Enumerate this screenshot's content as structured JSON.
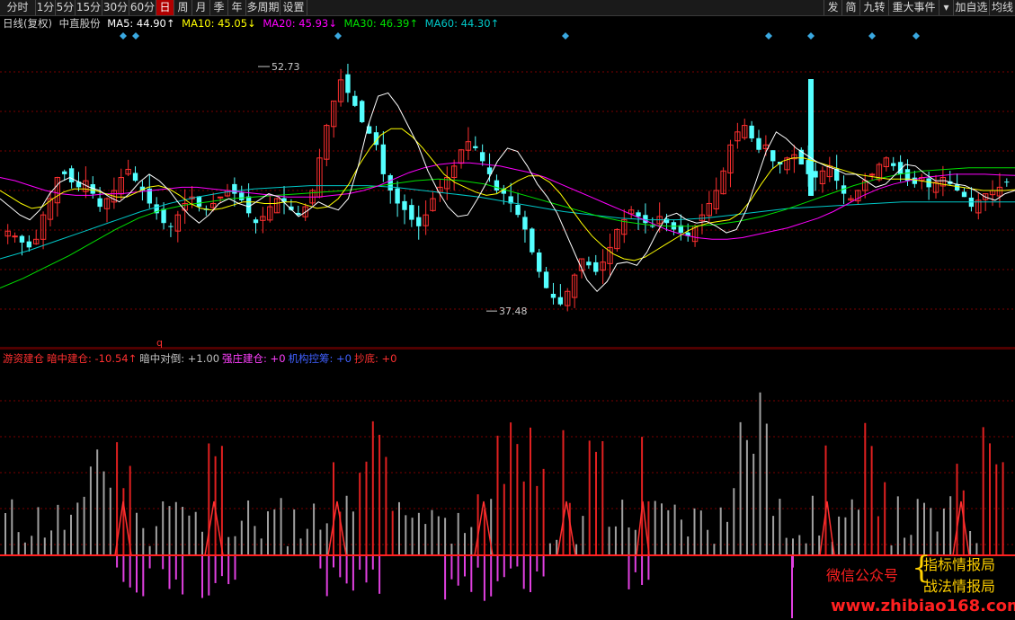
{
  "toolbar": {
    "left": [
      {
        "label": "分时",
        "icon": "candlestick-icon"
      },
      {
        "label": "1分"
      },
      {
        "label": "5分"
      },
      {
        "label": "15分"
      },
      {
        "label": "30分"
      },
      {
        "label": "60分"
      },
      {
        "label": "日",
        "active": true
      },
      {
        "label": "周"
      },
      {
        "label": "月"
      },
      {
        "label": "季"
      },
      {
        "label": "年"
      },
      {
        "label": "多周期"
      },
      {
        "label": "设置"
      }
    ],
    "right": [
      {
        "label": "发"
      },
      {
        "label": "简"
      },
      {
        "label": "九转"
      },
      {
        "label": "重大事件"
      },
      {
        "label": "▾",
        "icon": "dropdown-arrow-icon"
      },
      {
        "label": "加自选"
      },
      {
        "label": "均线"
      }
    ]
  },
  "legend": {
    "period": "日线(复权)",
    "stock": "中直股份",
    "ma5": {
      "label": "MA5: 44.90↑",
      "color": "#ffffff"
    },
    "ma10": {
      "label": "MA10: 45.05↓",
      "color": "#ffff00"
    },
    "ma20": {
      "label": "MA20: 45.93↓",
      "color": "#ff00ff"
    },
    "ma30": {
      "label": "MA30: 46.39↑",
      "color": "#00e000"
    },
    "ma60": {
      "label": "MA60: 44.30↑",
      "color": "#00c8c8"
    }
  },
  "annotations": {
    "high_label": "52.73",
    "low_label": "37.48",
    "q_marker": "q"
  },
  "indicator_legend": {
    "items": [
      {
        "label": "游资建仓",
        "color": "#ff3030"
      },
      {
        "label": "暗中建仓: -10.54↑",
        "color": "#ff3030"
      },
      {
        "label": "暗中对倒: +1.00",
        "color": "#c0c0c0"
      },
      {
        "label": "强庄建仓: +0",
        "color": "#ff40ff"
      },
      {
        "label": "机构控筹: +0",
        "color": "#4060ff"
      },
      {
        "label": "抄底: +0",
        "color": "#ff3030"
      }
    ]
  },
  "watermark": {
    "wechat": "微信公众号",
    "brace": "{",
    "line1": "指标情报局",
    "line2": "战法情报局",
    "url": "www.zhibiao168.com"
  },
  "colors": {
    "up": "#ff3030",
    "down": "#54ffff",
    "grid": "#7a0000",
    "ma5": "#ffffff",
    "ma10": "#ffff00",
    "ma20": "#ff00ff",
    "ma30": "#00e000",
    "ma60": "#00c8c8"
  },
  "chart_data": {
    "type": "candlestick",
    "price_range": [
      35.5,
      54.5
    ],
    "high": 52.73,
    "low": 37.48,
    "close_trace": [
      42.5,
      42.2,
      41.8,
      41.5,
      42.0,
      43.5,
      44.5,
      45.8,
      46.0,
      45.5,
      45.2,
      45.6,
      44.8,
      44.0,
      44.5,
      45.0,
      45.8,
      46.3,
      45.6,
      45.0,
      44.2,
      43.6,
      43.0,
      42.8,
      43.5,
      44.2,
      44.6,
      44.0,
      43.8,
      44.2,
      44.6,
      45.0,
      44.8,
      44.4,
      43.6,
      43.0,
      43.4,
      44.0,
      44.5,
      44.3,
      43.8,
      43.5,
      44.0,
      45.0,
      47.0,
      49.0,
      50.5,
      51.8,
      51.0,
      50.2,
      49.2,
      48.5,
      47.8,
      46.0,
      45.0,
      44.2,
      43.8,
      43.2,
      42.8,
      43.5,
      44.5,
      45.2,
      45.8,
      46.5,
      47.5,
      48.0,
      47.6,
      46.8,
      46.0,
      45.0,
      44.8,
      44.2,
      43.5,
      42.6,
      41.2,
      40.0,
      39.0,
      38.4,
      38.0,
      38.8,
      39.8,
      40.8,
      40.4,
      40.0,
      40.6,
      41.5,
      42.6,
      43.2,
      43.8,
      43.4,
      43.0,
      42.8,
      43.4,
      43.0,
      42.6,
      42.4,
      42.2,
      42.8,
      43.5,
      44.2,
      45.0,
      46.2,
      47.8,
      48.6,
      49.0,
      48.2,
      47.5,
      47.8,
      46.8,
      46.6,
      47.0,
      47.2,
      46.6,
      46.0,
      45.8,
      46.2,
      46.5,
      45.6,
      44.8,
      44.5,
      45.0,
      45.6,
      46.0,
      46.6,
      47.0,
      46.5,
      46.0,
      45.6,
      45.4,
      45.8,
      45.2,
      45.5,
      45.8,
      45.4,
      45.0,
      44.6,
      44.0,
      44.4,
      44.8,
      45.0,
      45.2,
      45.5
    ],
    "ma_curves": {
      "ma5": [
        44.5,
        44.0,
        43.5,
        43.2,
        43.8,
        44.8,
        45.5,
        45.8,
        45.5,
        45.2,
        45.0,
        44.6,
        44.3,
        44.8,
        45.5,
        46.0,
        45.6,
        45.0,
        44.2,
        43.5,
        43.0,
        43.5,
        44.2,
        44.5,
        44.2,
        44.0,
        44.4,
        44.8,
        44.6,
        44.0,
        43.4,
        43.8,
        44.3,
        44.0,
        43.8,
        44.5,
        46.5,
        49.0,
        50.8,
        51.0,
        50.2,
        49.0,
        47.8,
        46.2,
        45.0,
        44.0,
        43.4,
        43.5,
        44.5,
        45.6,
        46.8,
        47.6,
        47.4,
        46.5,
        45.4,
        44.6,
        43.6,
        42.2,
        40.8,
        39.5,
        38.8,
        39.4,
        40.5,
        40.6,
        40.4,
        41.2,
        42.4,
        43.4,
        43.6,
        43.2,
        43.0,
        43.1,
        42.8,
        42.4,
        42.6,
        43.8,
        45.6,
        47.4,
        48.6,
        48.2,
        47.6,
        47.2,
        46.8,
        46.5,
        46.3,
        46.0,
        46.0,
        45.6,
        45.2,
        45.4,
        46.0,
        46.6,
        46.5,
        46.0,
        45.6,
        45.6,
        45.4,
        45.3,
        45.0,
        44.6,
        44.4,
        44.8,
        45.0
      ],
      "ma10": [
        45.0,
        44.6,
        44.2,
        43.9,
        44.0,
        44.5,
        44.9,
        45.1,
        45.1,
        45.0,
        44.8,
        44.6,
        44.6,
        44.9,
        45.2,
        45.3,
        45.1,
        44.7,
        44.2,
        43.9,
        43.8,
        43.9,
        44.1,
        44.3,
        44.3,
        44.2,
        44.2,
        44.3,
        44.3,
        44.1,
        43.9,
        44.0,
        44.5,
        45.4,
        46.6,
        47.6,
        48.4,
        48.8,
        48.8,
        48.3,
        47.6,
        46.8,
        46.0,
        45.5,
        45.2,
        44.9,
        44.7,
        44.8,
        45.2,
        45.6,
        45.9,
        45.9,
        45.5,
        44.8,
        43.9,
        43.0,
        42.2,
        41.6,
        41.1,
        40.8,
        40.7,
        40.9,
        41.3,
        41.7,
        42.1,
        42.5,
        42.8,
        43.0,
        43.1,
        43.2,
        43.6,
        44.4,
        45.4,
        46.3,
        46.8,
        47.0,
        47.0,
        46.8,
        46.6,
        46.4,
        46.2,
        46.0,
        45.9,
        45.8,
        45.7,
        45.7,
        45.7,
        45.6,
        45.5,
        45.4,
        45.3,
        45.2,
        45.1,
        45.0,
        45.0,
        45.0,
        45.05
      ],
      "ma20": [
        45.8,
        45.6,
        45.3,
        45.0,
        44.8,
        44.7,
        44.7,
        44.8,
        44.8,
        44.9,
        45.0,
        45.1,
        45.2,
        45.2,
        45.1,
        45.0,
        44.9,
        44.8,
        44.7,
        44.6,
        44.6,
        44.6,
        44.7,
        44.8,
        45.0,
        45.3,
        45.7,
        46.1,
        46.4,
        46.6,
        46.7,
        46.7,
        46.6,
        46.5,
        46.3,
        46.1,
        45.8,
        45.4,
        45.0,
        44.6,
        44.2,
        43.8,
        43.4,
        43.0,
        42.6,
        42.3,
        42.1,
        42.0,
        42.0,
        42.1,
        42.3,
        42.5,
        42.7,
        43.0,
        43.3,
        43.7,
        44.2,
        44.7,
        45.1,
        45.4,
        45.6,
        45.8,
        45.9,
        46.0,
        46.0,
        46.0,
        45.95,
        45.93
      ],
      "ma30": [
        39.0,
        39.6,
        40.3,
        41.0,
        41.8,
        42.6,
        43.3,
        43.8,
        44.1,
        44.3,
        44.5,
        44.6,
        44.7,
        44.8,
        44.9,
        45.0,
        45.2,
        45.4,
        45.6,
        45.7,
        45.6,
        45.4,
        45.0,
        44.6,
        44.2,
        43.8,
        43.4,
        43.1,
        42.9,
        42.8,
        42.8,
        42.9,
        43.1,
        43.4,
        43.8,
        44.3,
        44.8,
        45.3,
        45.7,
        46.0,
        46.2,
        46.3,
        46.4,
        46.4,
        46.39
      ],
      "ma60": [
        40.8,
        41.3,
        41.9,
        42.5,
        43.1,
        43.7,
        44.2,
        44.6,
        44.9,
        45.1,
        45.2,
        45.3,
        45.3,
        45.3,
        45.2,
        45.0,
        44.8,
        44.6,
        44.3,
        44.0,
        43.7,
        43.5,
        43.3,
        43.2,
        43.2,
        43.3,
        43.5,
        43.7,
        43.9,
        44.0,
        44.1,
        44.2,
        44.3,
        44.3,
        44.3,
        44.3,
        44.3
      ]
    },
    "indicator": {
      "gray": [
        5,
        3,
        8,
        12,
        6,
        4,
        10,
        15,
        20,
        12,
        9,
        25,
        30,
        6,
        12,
        8,
        5,
        3,
        2,
        2,
        3,
        4,
        5,
        6,
        7,
        8,
        9,
        10,
        4,
        3,
        2,
        1,
        0,
        0,
        0,
        0,
        0,
        1,
        2,
        3,
        4,
        5,
        6,
        7,
        8,
        9,
        10,
        12,
        14,
        10,
        8,
        6,
        5,
        4,
        3,
        2,
        2,
        3,
        4,
        5,
        6,
        7,
        8,
        9,
        10,
        11,
        12,
        13,
        14,
        15,
        10,
        8,
        6,
        5,
        4,
        3,
        2,
        3,
        5,
        8,
        12,
        16,
        20,
        25,
        28,
        22,
        18,
        14,
        10,
        8,
        6
      ],
      "red_blocks": [
        [
          0,
          0
        ]
      ],
      "sub_range": [
        -30,
        90
      ]
    }
  }
}
